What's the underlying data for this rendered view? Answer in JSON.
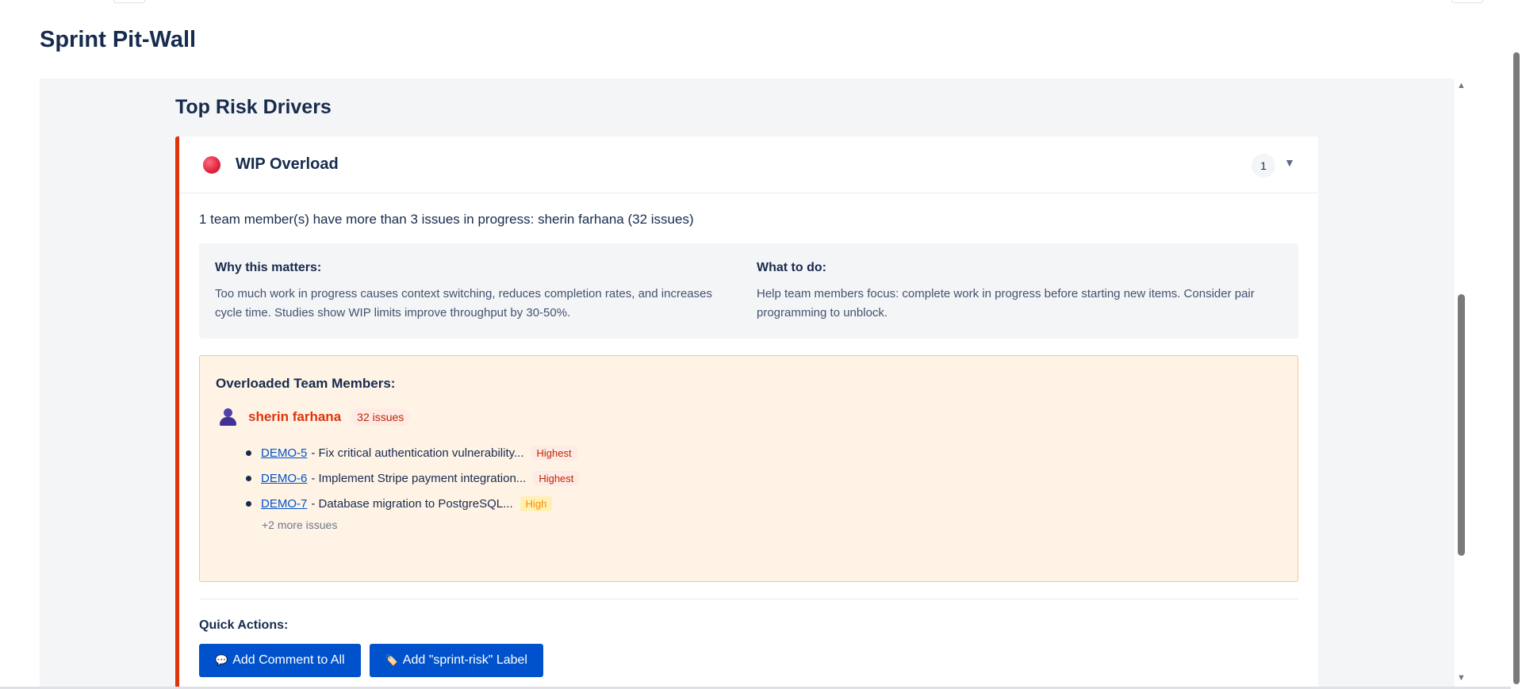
{
  "page": {
    "title": "Sprint Pit-Wall"
  },
  "section": {
    "heading": "Top Risk Drivers"
  },
  "risk": {
    "title": "WIP Overload",
    "count": "1",
    "chevron": "▼",
    "severity_color": "#de350b",
    "summary": "1 team member(s) have more than 3 issues in progress: sherin farhana (32 issues)",
    "why": {
      "heading": "Why this matters:",
      "text": "Too much work in progress causes context switching, reduces completion rates, and increases cycle time. Studies show WIP limits improve throughput by 30-50%."
    },
    "what": {
      "heading": "What to do:",
      "text": "Help team members focus: complete work in progress before starting new items. Consider pair programming to unblock."
    },
    "overloaded": {
      "heading": "Overloaded Team Members:",
      "member": {
        "name": "sherin farhana",
        "badge": "32 issues",
        "icon": "person-icon"
      },
      "issues": [
        {
          "key": "DEMO-5",
          "summary": "- Fix critical authentication vulnerability...",
          "priority": "Highest"
        },
        {
          "key": "DEMO-6",
          "summary": "- Implement Stripe payment integration...",
          "priority": "Highest"
        },
        {
          "key": "DEMO-7",
          "summary": "- Database migration to PostgreSQL...",
          "priority": "High"
        }
      ],
      "more": "+2 more issues"
    },
    "quick_actions": {
      "heading": "Quick Actions:",
      "comment_icon": "💬",
      "comment_label": "Add Comment to All",
      "label_icon": "🏷️",
      "label_label": "Add \"sprint-risk\" Label"
    }
  },
  "scrollbar": {
    "up": "▲",
    "down": "▼"
  }
}
